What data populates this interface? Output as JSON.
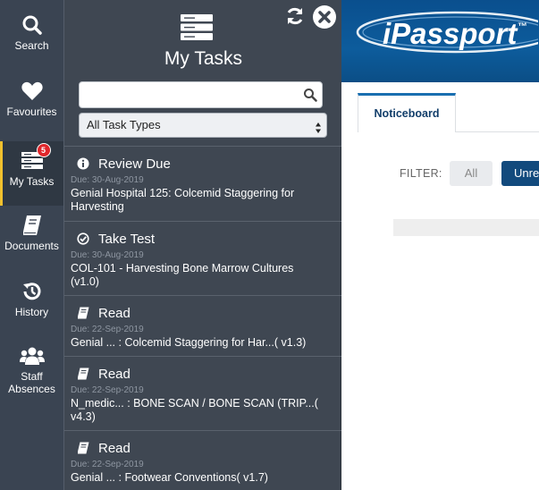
{
  "colors": {
    "nav_bg": "#3a4452",
    "panel_bg": "#3f4752",
    "active_indicator": "#f2c12e",
    "badge_red": "#e0262b",
    "header_blue": "#0d5c9c",
    "filter_button_blue": "#124a7d",
    "due_text_gray": "#8e96a1"
  },
  "nav": {
    "items": [
      {
        "label": "Search",
        "icon": "search-icon"
      },
      {
        "label": "Favourites",
        "icon": "heart-icon"
      },
      {
        "label": "My Tasks",
        "icon": "server-stack-icon",
        "badge": "5",
        "active": true
      },
      {
        "label": "Documents",
        "icon": "book-icon"
      },
      {
        "label": "History",
        "icon": "history-icon"
      },
      {
        "label": "Staff\nAbsences",
        "label_line1": "Staff",
        "label_line2": "Absences",
        "icon": "users-icon"
      }
    ]
  },
  "panel": {
    "title": "My Tasks",
    "search_placeholder": "",
    "search_value": "",
    "type_filter_selected": "All Task Types",
    "icons": [
      "server-stack-icon",
      "refresh-icon",
      "close-icon",
      "search-icon"
    ]
  },
  "tasks": [
    {
      "type": "Review Due",
      "icon": "info-circle-icon",
      "due": "Due: 30-Aug-2019",
      "desc_line1": "Genial Hospital 125: Colcemid Staggering for",
      "desc_line2": "Harvesting"
    },
    {
      "type": "Take Test",
      "icon": "check-circle-icon",
      "due": "Due: 30-Aug-2019",
      "desc_line1": "COL-101 - Harvesting Bone Marrow Cultures",
      "desc_line2": "(v1.0)"
    },
    {
      "type": "Read",
      "icon": "book-icon",
      "due": "Due: 22-Sep-2019",
      "desc_line1": "Genial ... : Colcemid Staggering for Har...( v1.3)",
      "desc_line2": ""
    },
    {
      "type": "Read",
      "icon": "book-icon",
      "due": "Due: 22-Sep-2019",
      "desc_line1": "N_medic... : BONE SCAN / BONE SCAN (TRIP...(",
      "desc_line2": "v4.3)"
    },
    {
      "type": "Read",
      "icon": "book-icon",
      "due": "Due: 22-Sep-2019",
      "desc_line1": "Genial ... : Footwear Conventions( v1.7)",
      "desc_line2": ""
    }
  ],
  "app": {
    "logo_text": "iPassport",
    "logo_tm": "™",
    "tab_label": "Noticeboard",
    "filter_label": "FILTER:",
    "filter_all": "All",
    "filter_unread": "Unre"
  }
}
